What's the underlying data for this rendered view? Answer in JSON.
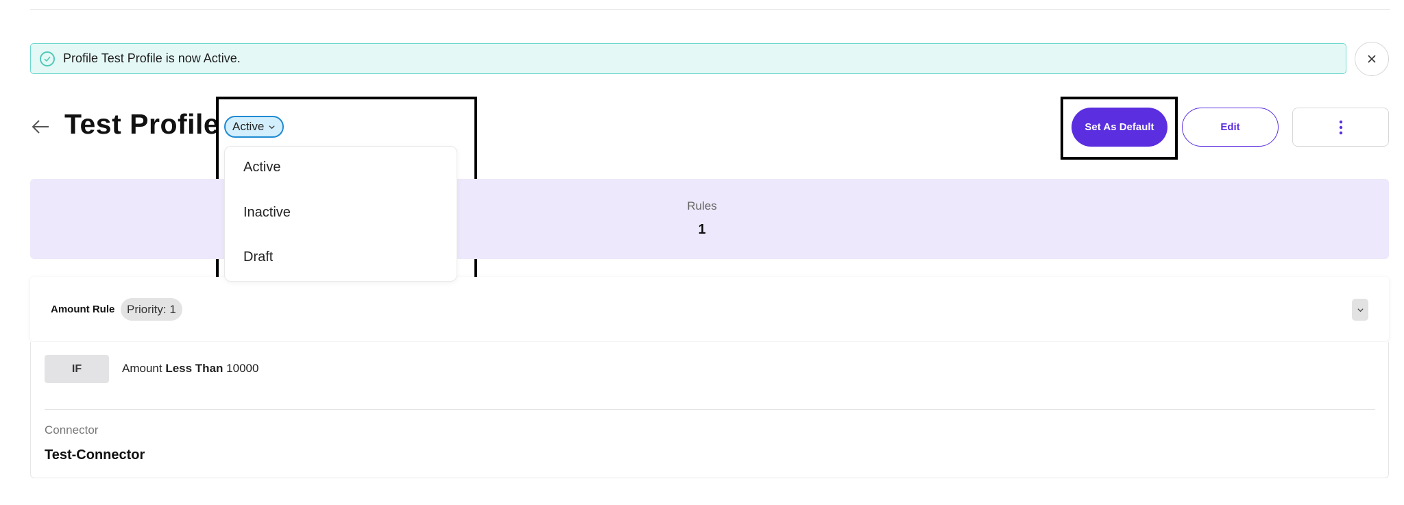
{
  "notification": {
    "message": "Profile Test Profile is now Active."
  },
  "header": {
    "title": "Test Profile",
    "status": "Active",
    "status_options": [
      "Active",
      "Inactive",
      "Draft"
    ],
    "set_default_label": "Set As Default",
    "edit_label": "Edit"
  },
  "summary": {
    "label": "Rules",
    "value": "1"
  },
  "rule": {
    "name": "Amount Rule",
    "priority": "Priority: 1",
    "condition_keyword": "IF",
    "field": "Amount",
    "operator": "Less Than",
    "value": "10000",
    "connector_label": "Connector",
    "connector_value": "Test-Connector"
  },
  "colors": {
    "accent": "#5b2ee0",
    "alert_bg": "#e4f9f6",
    "summary_bg": "#ede8fb",
    "status_chip_bg": "#d3eefc"
  },
  "icons": {
    "alert": "check-circle-icon",
    "close": "close-icon",
    "back": "arrow-left-icon",
    "status_chevron": "chevron-down-icon",
    "more": "vertical-dots-icon",
    "collapse": "chevron-down-icon"
  }
}
